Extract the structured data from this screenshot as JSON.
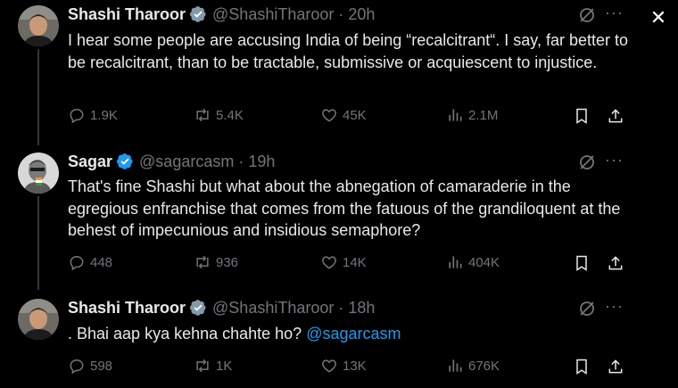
{
  "tweets": [
    {
      "name": "Shashi Tharoor",
      "handle": "@ShashiTharoor",
      "separator": "·",
      "time": "20h",
      "text": "I hear some people are accusing India of being “recalcitrant“. I say, far better to be recalcitrant, than to be tractable, submissive or acquiescent to injustice.",
      "mention": "",
      "replies": "1.9K",
      "reposts": "5.4K",
      "likes": "45K",
      "views": "2.1M",
      "verified_badge": "gray"
    },
    {
      "name": "Sagar",
      "handle": "@sagarcasm",
      "separator": "·",
      "time": "19h",
      "text": "That's fine Shashi but what about the abnegation of camaraderie in the egregious enfranchise that comes from the fatuous of the grandiloquent at the behest of impecunious and insidious semaphore?",
      "mention": "",
      "replies": "448",
      "reposts": "936",
      "likes": "14K",
      "views": "404K",
      "verified_badge": "blue"
    },
    {
      "name": "Shashi Tharoor",
      "handle": "@ShashiTharoor",
      "separator": "·",
      "time": "18h",
      "text": ". Bhai aap kya kehna chahte ho? ",
      "mention": "@sagarcasm",
      "replies": "598",
      "reposts": "1K",
      "likes": "13K",
      "views": "676K",
      "verified_badge": "gray"
    }
  ],
  "colors": {
    "background": "#000000",
    "text": "#e7e9ea",
    "muted": "#71767b",
    "accent": "#1d9bf0",
    "verified_gray": "#829aab",
    "verified_blue": "#1d9bf0"
  },
  "icons": [
    "close-icon",
    "avatar",
    "verified-icon",
    "grok-icon",
    "more-icon",
    "reply-icon",
    "repost-icon",
    "like-icon",
    "views-icon",
    "bookmark-icon",
    "share-icon"
  ]
}
